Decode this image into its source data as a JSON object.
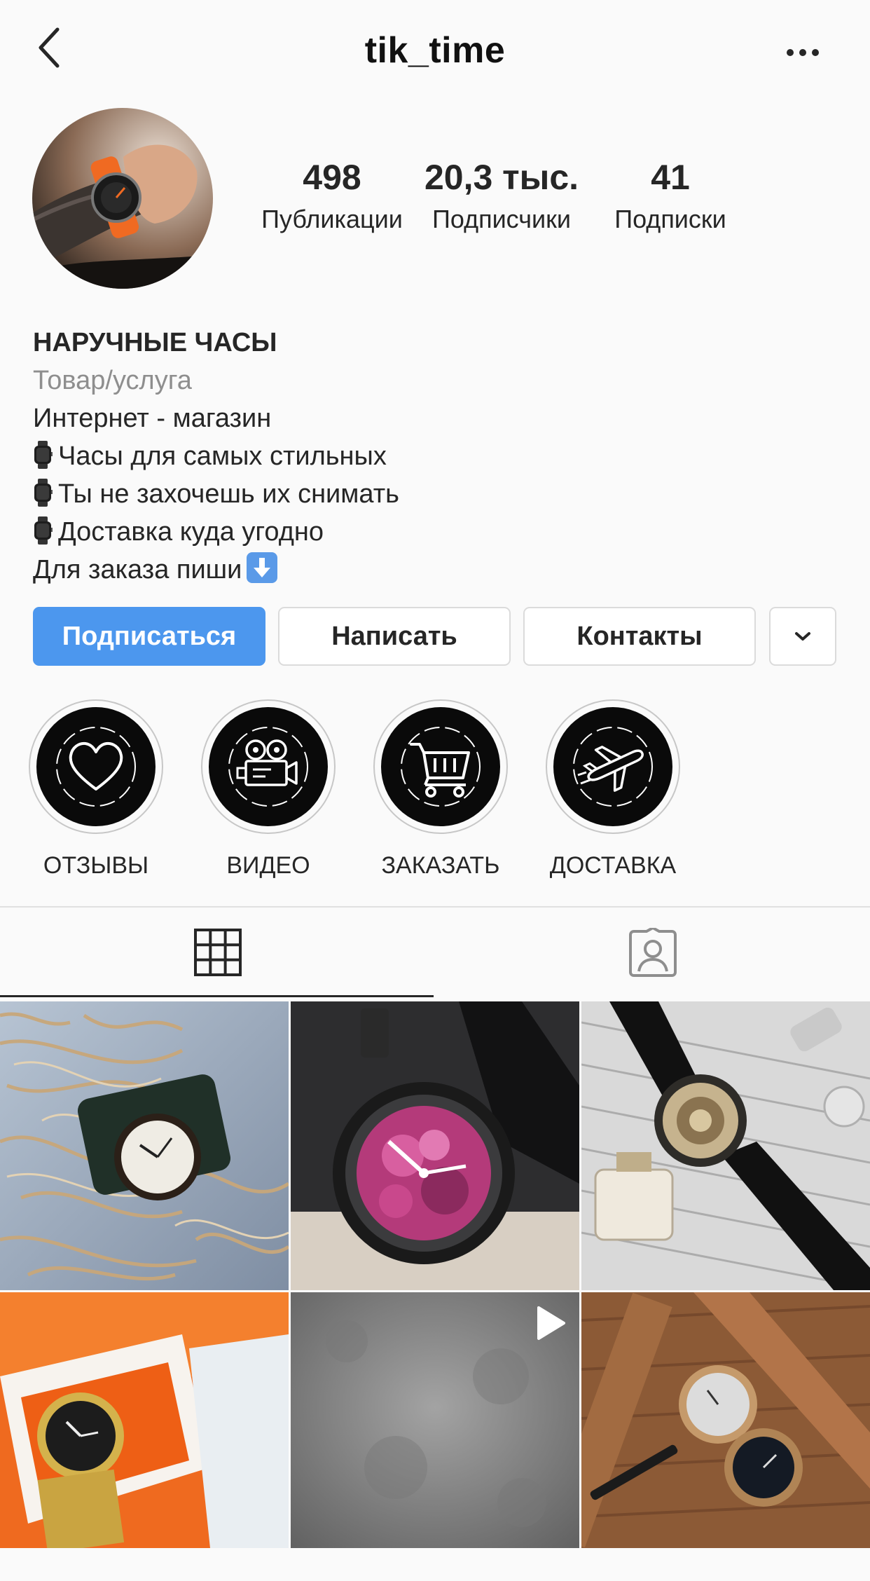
{
  "header": {
    "username": "tik_time",
    "back_icon": "chevron-left-icon",
    "more_icon": "more-horizontal-icon"
  },
  "stats": {
    "posts": {
      "value": "498",
      "label": "Публикации"
    },
    "followers": {
      "value": "20,3 тыс.",
      "label": "Подписчики"
    },
    "following": {
      "value": "41",
      "label": "Подписки"
    }
  },
  "bio": {
    "name": "НАРУЧНЫЕ ЧАСЫ",
    "category": "Товар/услуга",
    "lines": [
      "Интернет - магазин",
      "Часы для самых стильных",
      "Ты не захочешь их снимать",
      "Доставка куда угодно",
      "Для заказа пиши"
    ]
  },
  "buttons": {
    "follow": "Подписаться",
    "message": "Написать",
    "contacts": "Контакты",
    "more_icon": "chevron-down-icon"
  },
  "highlights": [
    {
      "label": "ОТЗЫВЫ",
      "icon": "heart-icon"
    },
    {
      "label": "ВИДЕО",
      "icon": "video-camera-icon"
    },
    {
      "label": "ЗАКАЗАТЬ",
      "icon": "shopping-cart-icon"
    },
    {
      "label": "ДОСТАВКА",
      "icon": "airplane-icon"
    }
  ],
  "tabs": [
    {
      "name": "grid",
      "icon": "grid-icon",
      "active": true
    },
    {
      "name": "tagged",
      "icon": "tagged-user-icon",
      "active": false
    }
  ],
  "posts": [
    {
      "type": "photo",
      "subject": "watch-in-straw"
    },
    {
      "type": "photo",
      "subject": "pink-camo-watch"
    },
    {
      "type": "photo",
      "subject": "skeleton-watch-with-perfume"
    },
    {
      "type": "photo",
      "subject": "panerai-box"
    },
    {
      "type": "video",
      "subject": "concrete-background",
      "overlay_icon": "play-icon"
    },
    {
      "type": "photo",
      "subject": "wooden-watches"
    }
  ],
  "colors": {
    "accent": "#4c97ee",
    "background": "#fafafa",
    "text": "#262626",
    "secondary_text": "#8e8e8e",
    "border": "#dbdbdb"
  }
}
